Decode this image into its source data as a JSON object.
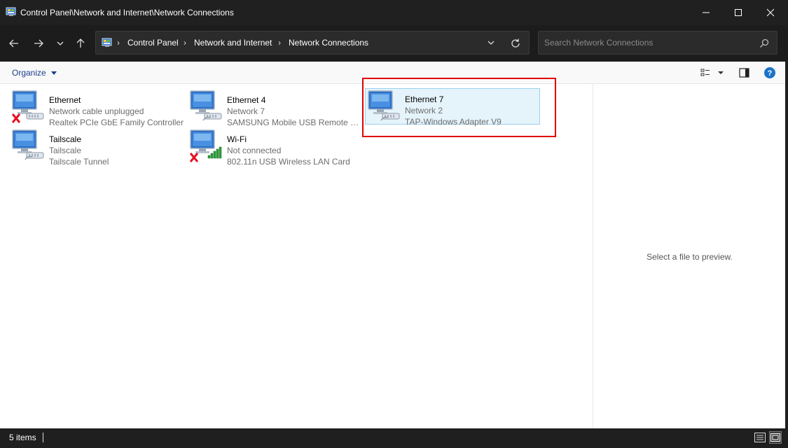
{
  "window": {
    "title": "Control Panel\\Network and Internet\\Network Connections"
  },
  "address": {
    "crumbs": [
      "Control Panel",
      "Network and Internet",
      "Network Connections"
    ]
  },
  "search": {
    "placeholder": "Search Network Connections"
  },
  "commandbar": {
    "organize_label": "Organize"
  },
  "connections": [
    {
      "name": "Ethernet",
      "status": "Network cable unplugged",
      "device": "Realtek PCIe GbE Family Controller",
      "icon": "ethernet-disconnected-icon"
    },
    {
      "name": "Ethernet 4",
      "status": "Network 7",
      "device": "SAMSUNG Mobile USB Remote N...",
      "icon": "ethernet-connected-icon"
    },
    {
      "name": "Ethernet 7",
      "status": "Network 2",
      "device": "TAP-Windows Adapter V9",
      "icon": "ethernet-connected-icon",
      "selected": true
    },
    {
      "name": "Tailscale",
      "status": "Tailscale",
      "device": "Tailscale Tunnel",
      "icon": "ethernet-connected-icon"
    },
    {
      "name": "Wi-Fi",
      "status": "Not connected",
      "device": "802.11n USB Wireless LAN Card",
      "icon": "wifi-disconnected-icon"
    }
  ],
  "preview": {
    "text": "Select a file to preview."
  },
  "status": {
    "items_count": "5 items"
  },
  "colors": {
    "accent": "#0078d4",
    "highlight_border": "#e00000",
    "selected_bg": "#e5f3fb",
    "error_red": "#e81123",
    "signal_green": "#2c9f3a"
  }
}
